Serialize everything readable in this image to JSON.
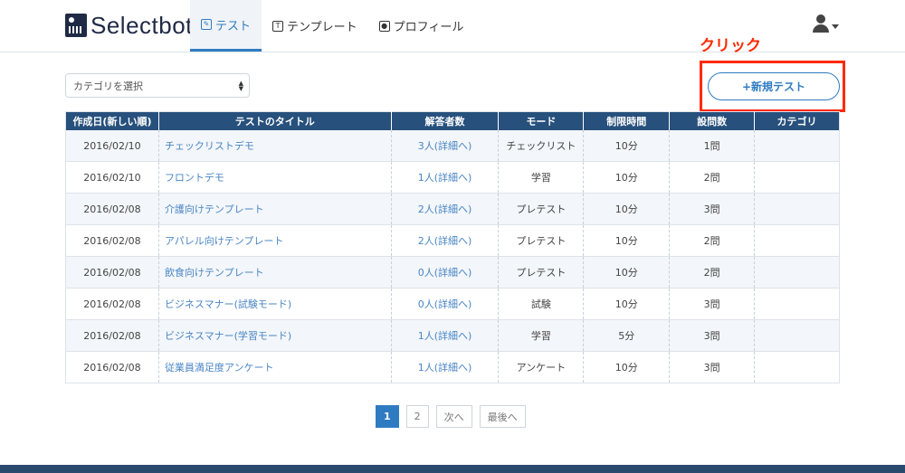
{
  "header": {
    "logo_text": "Selectbot",
    "tabs": [
      {
        "label": "テスト",
        "icon": "edit-icon",
        "active": true
      },
      {
        "label": "テンプレート",
        "icon": "template-icon",
        "active": false
      },
      {
        "label": "プロフィール",
        "icon": "profile-icon",
        "active": false
      }
    ],
    "user_icon": "user-icon"
  },
  "annotation": {
    "label": "クリック",
    "color": "#ff2a00"
  },
  "controls": {
    "category_select_value": "カテゴリを選択",
    "new_test_label": "+新規テスト"
  },
  "table": {
    "headers": [
      "作成日(新しい順)",
      "テストのタイトル",
      "解答者数",
      "モード",
      "制限時間",
      "設問数",
      "カテゴリ"
    ],
    "rows": [
      {
        "date": "2016/02/10",
        "title": "チェックリストデモ",
        "respondents": "3人(詳細へ)",
        "mode": "チェックリスト",
        "time": "10分",
        "questions": "1問",
        "category": ""
      },
      {
        "date": "2016/02/10",
        "title": "フロントデモ",
        "respondents": "1人(詳細へ)",
        "mode": "学習",
        "time": "10分",
        "questions": "2問",
        "category": ""
      },
      {
        "date": "2016/02/08",
        "title": "介護向けテンプレート",
        "respondents": "2人(詳細へ)",
        "mode": "プレテスト",
        "time": "10分",
        "questions": "3問",
        "category": ""
      },
      {
        "date": "2016/02/08",
        "title": "アパレル向けテンプレート",
        "respondents": "2人(詳細へ)",
        "mode": "プレテスト",
        "time": "10分",
        "questions": "2問",
        "category": ""
      },
      {
        "date": "2016/02/08",
        "title": "飲食向けテンプレート",
        "respondents": "0人(詳細へ)",
        "mode": "プレテスト",
        "time": "10分",
        "questions": "2問",
        "category": ""
      },
      {
        "date": "2016/02/08",
        "title": "ビジネスマナー(試験モード)",
        "respondents": "0人(詳細へ)",
        "mode": "試験",
        "time": "10分",
        "questions": "3問",
        "category": ""
      },
      {
        "date": "2016/02/08",
        "title": "ビジネスマナー(学習モード)",
        "respondents": "1人(詳細へ)",
        "mode": "学習",
        "time": "5分",
        "questions": "3問",
        "category": ""
      },
      {
        "date": "2016/02/08",
        "title": "従業員満足度アンケート",
        "respondents": "1人(詳細へ)",
        "mode": "アンケート",
        "time": "10分",
        "questions": "3問",
        "category": ""
      }
    ]
  },
  "pagination": {
    "pages": [
      "1",
      "2"
    ],
    "current": "1",
    "next_label": "次へ",
    "last_label": "最後へ"
  },
  "colors": {
    "accent": "#2f7bc1",
    "table_header": "#27507c",
    "footer": "#2a4a6d"
  }
}
